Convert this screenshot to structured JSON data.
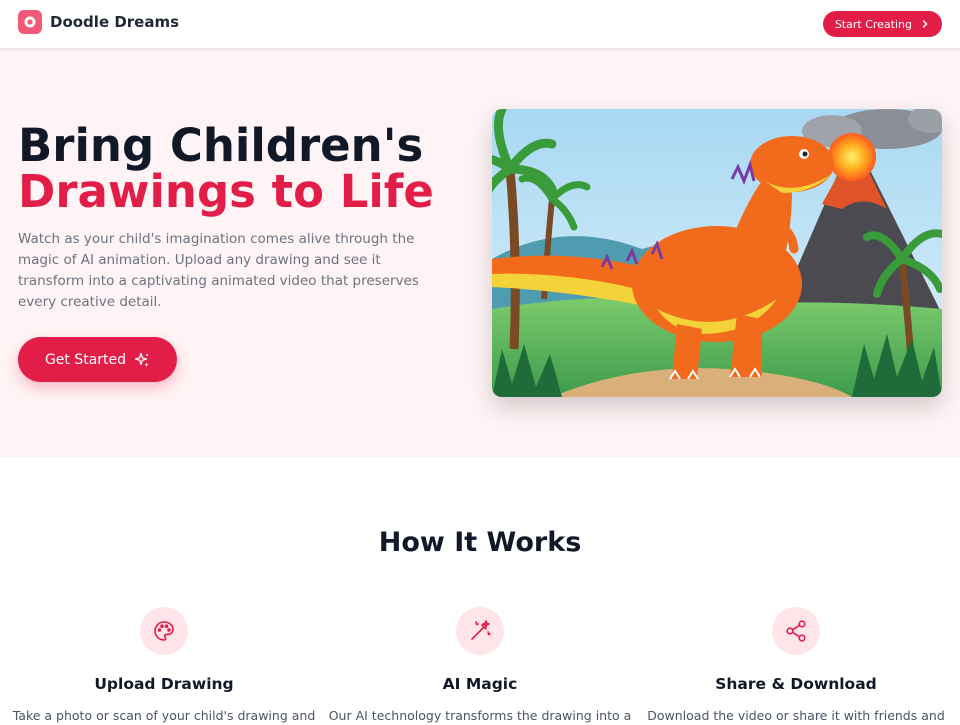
{
  "nav": {
    "brand": "Doodle Dreams",
    "cta_label": "Start Creating"
  },
  "hero": {
    "title_line1": "Bring Children's",
    "title_line2": "Drawings to Life",
    "description": "Watch as your child's imagination comes alive through the magic of AI animation. Upload any drawing and see it transform into a captivating animated video that preserves every creative detail.",
    "button_label": "Get Started",
    "image": "Children's crayon drawing of an orange dinosaur beside a volcano and palm trees"
  },
  "how_it_works": {
    "title": "How It Works",
    "features": [
      {
        "icon": "palette-icon",
        "title": "Upload Drawing",
        "description": "Take a photo or scan of your child's drawing and"
      },
      {
        "icon": "magic-wand-icon",
        "title": "AI Magic",
        "description": "Our AI technology transforms the drawing into a"
      },
      {
        "icon": "share-icon",
        "title": "Share & Download",
        "description": "Download the video or share it with friends and"
      }
    ]
  },
  "colors": {
    "accent": "#e11d48",
    "hero_bg": "#fff4f5",
    "icon_bg": "#ffe4e9"
  }
}
